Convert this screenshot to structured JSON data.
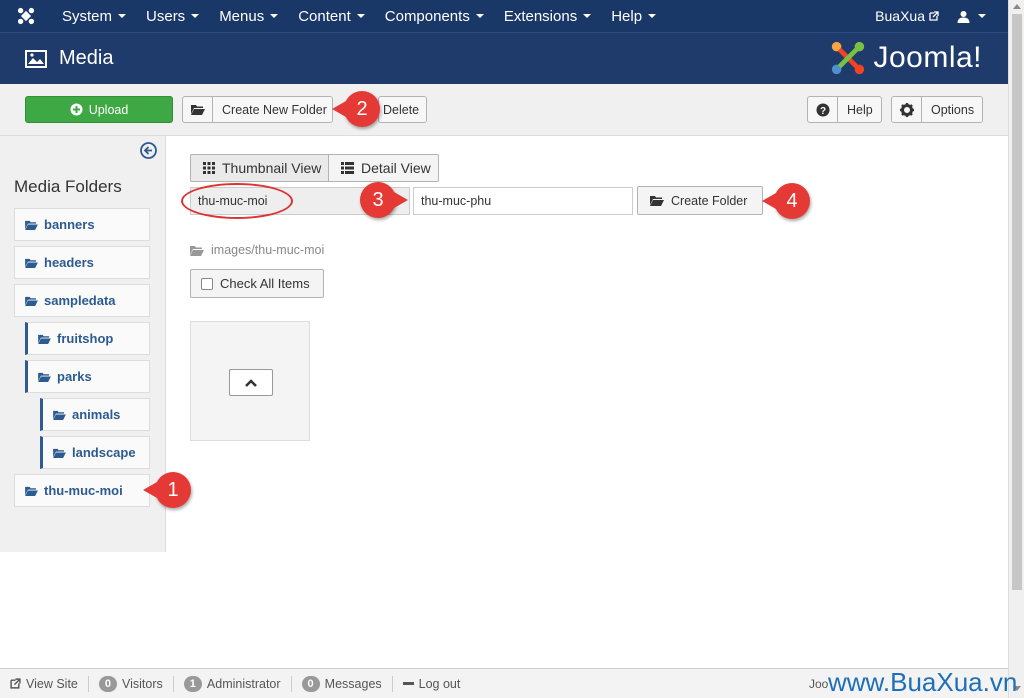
{
  "topbar": {
    "menu": [
      {
        "label": "System"
      },
      {
        "label": "Users"
      },
      {
        "label": "Menus"
      },
      {
        "label": "Content"
      },
      {
        "label": "Components"
      },
      {
        "label": "Extensions"
      },
      {
        "label": "Help"
      }
    ],
    "site_name": "BuaXua"
  },
  "header": {
    "title": "Media",
    "brand_text": "Joomla!"
  },
  "toolbar": {
    "upload_label": "Upload",
    "new_folder_label": "Create New Folder",
    "delete_label": "Delete",
    "help_label": "Help",
    "options_label": "Options"
  },
  "sidebar": {
    "heading": "Media Folders",
    "folders": [
      {
        "label": "banners"
      },
      {
        "label": "headers"
      },
      {
        "label": "sampledata"
      },
      {
        "label": "fruitshop"
      },
      {
        "label": "parks"
      },
      {
        "label": "animals"
      },
      {
        "label": "landscape"
      },
      {
        "label": "thu-muc-moi"
      }
    ]
  },
  "main": {
    "thumbnail_view_label": "Thumbnail View",
    "detail_view_label": "Detail View",
    "base_path_value": "thu-muc-moi",
    "subfolder_value": "thu-muc-phu",
    "create_folder_label": "Create Folder",
    "current_path": "images/thu-muc-moi",
    "check_all_label": "Check All Items"
  },
  "callouts": {
    "c1": "1",
    "c2": "2",
    "c3": "3",
    "c4": "4"
  },
  "status": {
    "view_site": "View Site",
    "visitors_count": "0",
    "visitors_label": "Visitors",
    "admin_count": "1",
    "admin_label": "Administrator",
    "messages_count": "0",
    "messages_label": "Messages",
    "logout_label": "Log out",
    "footer_text": "Joo"
  },
  "watermark": "www.BuaXua.vn",
  "colors": {
    "nav_bg": "#1a3867",
    "upload_green": "#3da844",
    "callout_red": "#e53935",
    "folder_blue": "#2c5b91"
  }
}
